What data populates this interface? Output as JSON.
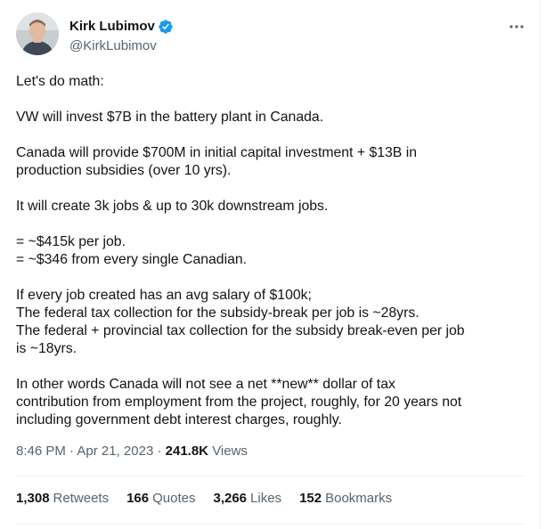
{
  "author": {
    "display_name": "Kirk Lubimov",
    "handle": "@KirkLubimov",
    "verified_icon": "verified-badge-icon",
    "avatar_icon": "avatar-photo"
  },
  "tweet": {
    "text": "Let's do math:\n\nVW will invest $7B in the battery plant in Canada.\n\nCanada will provide $700M in initial capital investment + $13B in\nproduction subsidies (over 10 yrs).\n\nIt will create 3k jobs & up to 30k downstream jobs.\n\n= ~$415k per job.\n= ~$346 from every single Canadian.\n\nIf every job created has an avg salary of $100k;\nThe federal tax collection for the subsidy-break per job is ~28yrs.\nThe federal + provincial tax collection for the subsidy break-even per job\nis ~18yrs.\n\nIn other words Canada will not see a net **new** dollar of tax\ncontribution from employment from the project, roughly, for 20 years not\nincluding government debt interest charges, roughly."
  },
  "meta": {
    "time": "8:46 PM",
    "separator": "·",
    "date": "Apr 21, 2023",
    "views_count": "241.8K",
    "views_label": "Views"
  },
  "stats": {
    "retweets": {
      "count": "1,308",
      "label": "Retweets"
    },
    "quotes": {
      "count": "166",
      "label": "Quotes"
    },
    "likes": {
      "count": "3,266",
      "label": "Likes"
    },
    "bookmarks": {
      "count": "152",
      "label": "Bookmarks"
    }
  },
  "colors": {
    "text": "#0f1419",
    "secondary": "#536471",
    "verified": "#1d9bf0",
    "divider": "#eff3f4"
  }
}
